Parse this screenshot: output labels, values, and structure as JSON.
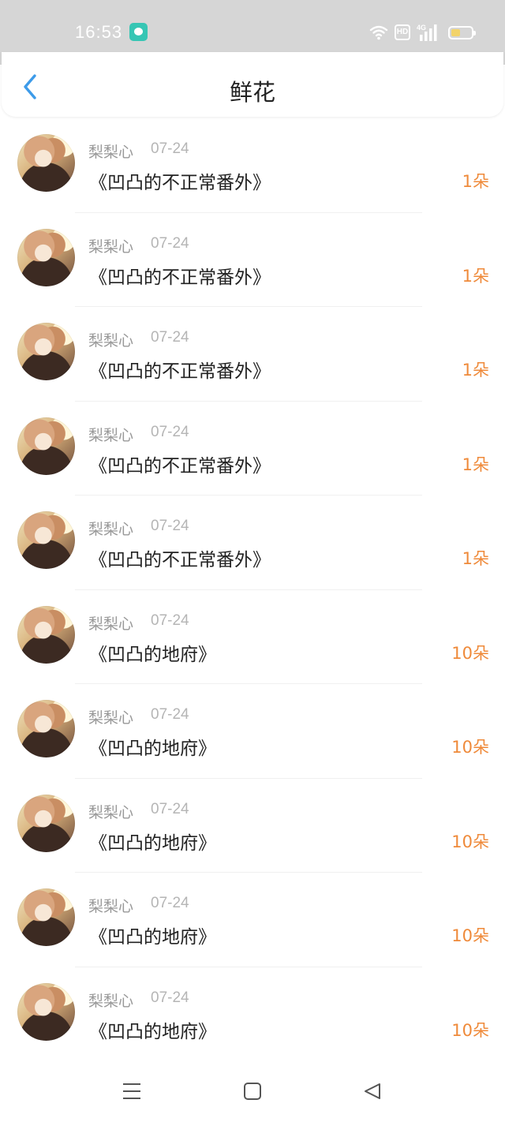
{
  "status_bar": {
    "time": "16:53",
    "network_label": "4G",
    "hd_label": "HD",
    "icons": [
      "app-notification-icon",
      "wifi-icon",
      "hd-icon",
      "signal-icon",
      "battery-icon"
    ]
  },
  "header": {
    "title": "鲜花",
    "back_icon": "chevron-left-icon",
    "accent_color": "#3d9be9"
  },
  "items": [
    {
      "name": "梨梨心",
      "date": "07-24",
      "title": "《凹凸的不正常番外》",
      "flowers": "1朵"
    },
    {
      "name": "梨梨心",
      "date": "07-24",
      "title": "《凹凸的不正常番外》",
      "flowers": "1朵"
    },
    {
      "name": "梨梨心",
      "date": "07-24",
      "title": "《凹凸的不正常番外》",
      "flowers": "1朵"
    },
    {
      "name": "梨梨心",
      "date": "07-24",
      "title": "《凹凸的不正常番外》",
      "flowers": "1朵"
    },
    {
      "name": "梨梨心",
      "date": "07-24",
      "title": "《凹凸的不正常番外》",
      "flowers": "1朵"
    },
    {
      "name": "梨梨心",
      "date": "07-24",
      "title": "《凹凸的地府》",
      "flowers": "10朵"
    },
    {
      "name": "梨梨心",
      "date": "07-24",
      "title": "《凹凸的地府》",
      "flowers": "10朵"
    },
    {
      "name": "梨梨心",
      "date": "07-24",
      "title": "《凹凸的地府》",
      "flowers": "10朵"
    },
    {
      "name": "梨梨心",
      "date": "07-24",
      "title": "《凹凸的地府》",
      "flowers": "10朵"
    },
    {
      "name": "梨梨心",
      "date": "07-24",
      "title": "《凹凸的地府》",
      "flowers": "10朵"
    }
  ],
  "colors": {
    "flower_count": "#ef8a3a",
    "status_bar": "#d6d6d6",
    "name_text": "#999999",
    "title_text": "#222222"
  },
  "nav_bar": {
    "icons": [
      "menu-icon",
      "home-square-icon",
      "back-triangle-icon"
    ]
  }
}
